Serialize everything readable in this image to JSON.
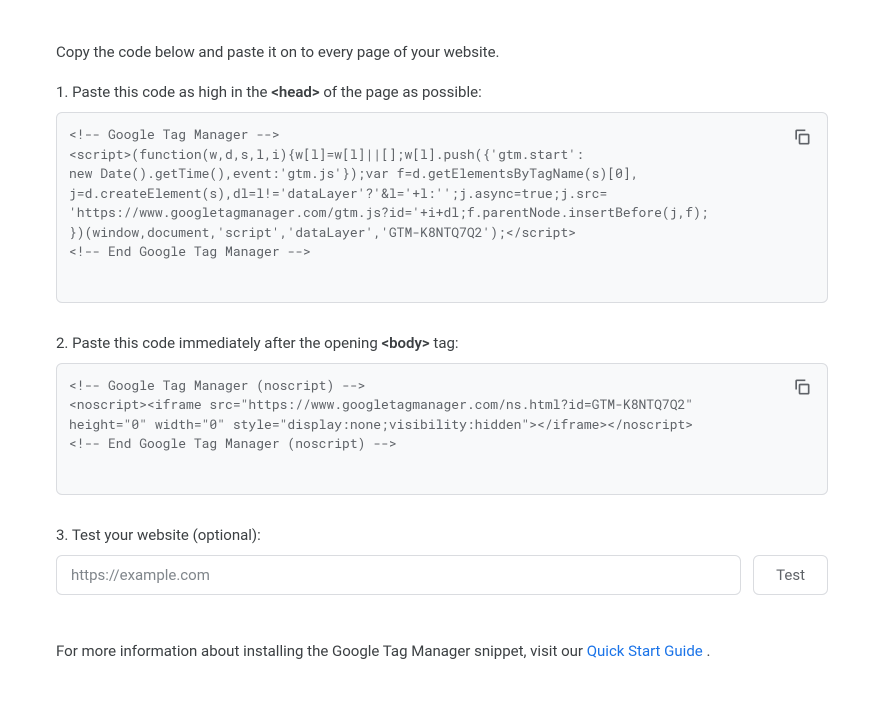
{
  "intro": "Copy the code below and paste it on to every page of your website.",
  "step1": {
    "prefix": "1. Paste this code as high in the ",
    "bold": "<head>",
    "suffix": " of the page as possible:",
    "code": "<!-- Google Tag Manager -->\n<script>(function(w,d,s,l,i){w[l]=w[l]||[];w[l].push({'gtm.start':\nnew Date().getTime(),event:'gtm.js'});var f=d.getElementsByTagName(s)[0],\nj=d.createElement(s),dl=l!='dataLayer'?'&l='+l:'';j.async=true;j.src=\n'https://www.googletagmanager.com/gtm.js?id='+i+dl;f.parentNode.insertBefore(j,f);\n})(window,document,'script','dataLayer','GTM-K8NTQ7Q2');</script>\n<!-- End Google Tag Manager -->"
  },
  "step2": {
    "prefix": "2. Paste this code immediately after the opening ",
    "bold": "<body>",
    "suffix": " tag:",
    "code": "<!-- Google Tag Manager (noscript) -->\n<noscript><iframe src=\"https://www.googletagmanager.com/ns.html?id=GTM-K8NTQ7Q2\"\nheight=\"0\" width=\"0\" style=\"display:none;visibility:hidden\"></iframe></noscript>\n<!-- End Google Tag Manager (noscript) -->"
  },
  "step3": {
    "label": "3. Test your website (optional):",
    "placeholder": "https://example.com",
    "button": "Test"
  },
  "footer": {
    "prefix": "For more information about installing the Google Tag Manager snippet, visit our ",
    "link": "Quick Start Guide",
    "suffix": " ."
  }
}
